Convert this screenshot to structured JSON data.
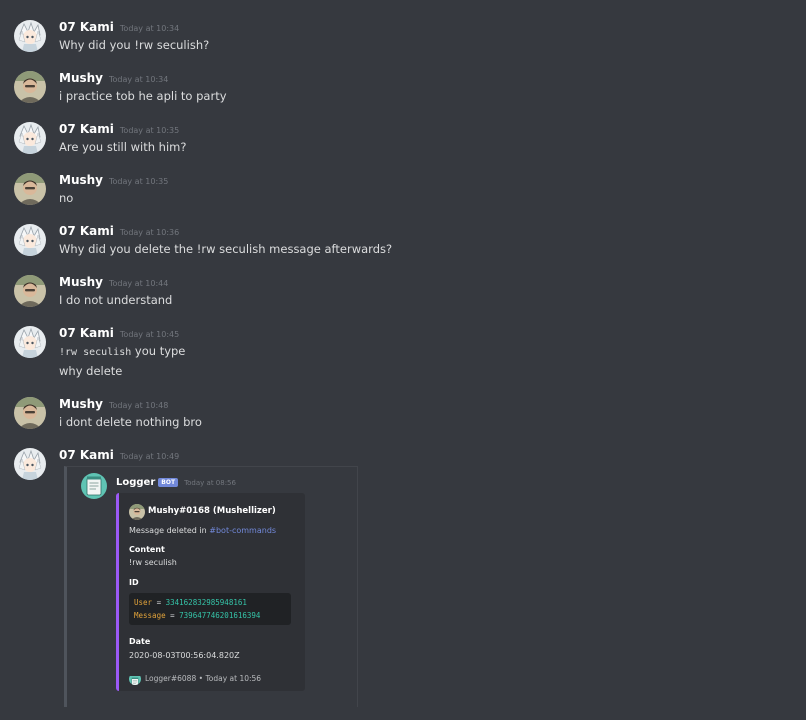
{
  "users": {
    "kami": "07 Kami",
    "mushy": "Mushy"
  },
  "messages": [
    {
      "author": "07 Kami",
      "time": "Today at 10:34",
      "lines": [
        "Why did you !rw seculish?"
      ]
    },
    {
      "author": "Mushy",
      "time": "Today at 10:34",
      "lines": [
        "i practice tob he apli to party"
      ]
    },
    {
      "author": "07 Kami",
      "time": "Today at 10:35",
      "lines": [
        "Are you still with him?"
      ]
    },
    {
      "author": "Mushy",
      "time": "Today at 10:35",
      "lines": [
        "no"
      ]
    },
    {
      "author": "07 Kami",
      "time": "Today at 10:36",
      "lines": [
        "Why did you delete the !rw seculish message afterwards?"
      ]
    },
    {
      "author": "Mushy",
      "time": "Today at 10:44",
      "lines": [
        "I do not understand"
      ]
    },
    {
      "author": "07 Kami",
      "time": "Today at 10:45",
      "code": "!rw seculish",
      "code_suffix": " you type",
      "lines": [
        "why delete"
      ]
    },
    {
      "author": "Mushy",
      "time": "Today at 10:48",
      "lines": [
        "i dont delete nothing bro"
      ]
    },
    {
      "author": "07 Kami",
      "time": "Today at 10:49",
      "lines": []
    }
  ],
  "quoted": {
    "author": "Logger",
    "bot_tag": "BOT",
    "time": "Today at 08:56",
    "embed": {
      "author": "Mushy#0168 (Mushellizer)",
      "description_prefix": "Message deleted in ",
      "channel": "#bot-commands",
      "content_label": "Content",
      "content_value": "!rw seculish",
      "id_label": "ID",
      "user_key": "User",
      "user_id": "334162832985948161",
      "message_key": "Message",
      "message_id": "739647746201616394",
      "date_label": "Date",
      "date_value": "2020-08-03T00:56:04.820Z",
      "footer_author": "Logger#6088",
      "footer_sep": "•",
      "footer_time": "Today at 10:56"
    }
  },
  "colors": {
    "background": "#36393f",
    "embed_bg": "#2f3136",
    "embed_accent": "#9b59f6",
    "link": "#7289da",
    "code_key": "#e0a23a",
    "code_value": "#35c4a8"
  },
  "icons": {
    "kami_avatar": "anime-character-avatar",
    "mushy_avatar": "photo-avatar",
    "logger_avatar": "notepad-icon"
  }
}
